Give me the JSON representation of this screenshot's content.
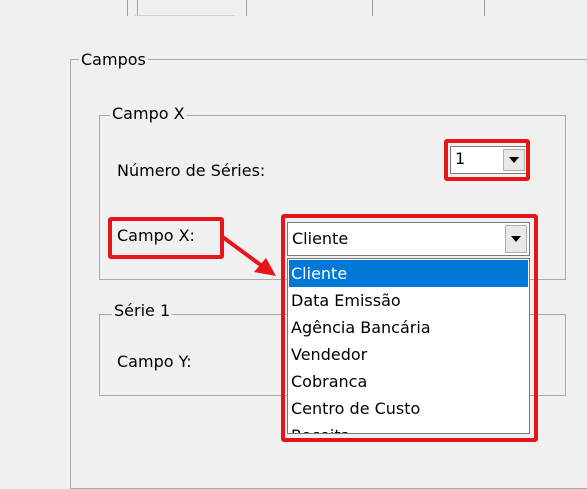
{
  "groups": {
    "campos_label": "Campos",
    "campo_x_label": "Campo X",
    "serie_label": "Série 1"
  },
  "campo_x_group": {
    "numero_series_label": "Número de Séries:",
    "numero_series_value": "1",
    "campo_x_label": "Campo X:",
    "campo_x_value": "Cliente",
    "options": [
      "Cliente",
      "Data Emissão",
      "Agência Bancária",
      "Vendedor",
      "Cobranca",
      "Centro de Custo",
      "Receita"
    ],
    "selected_index": 0
  },
  "serie_group": {
    "campo_y_label": "Campo Y:"
  },
  "colors": {
    "highlight": "#e6151c",
    "selection": "#0078d7",
    "background": "#f0f0f0"
  }
}
